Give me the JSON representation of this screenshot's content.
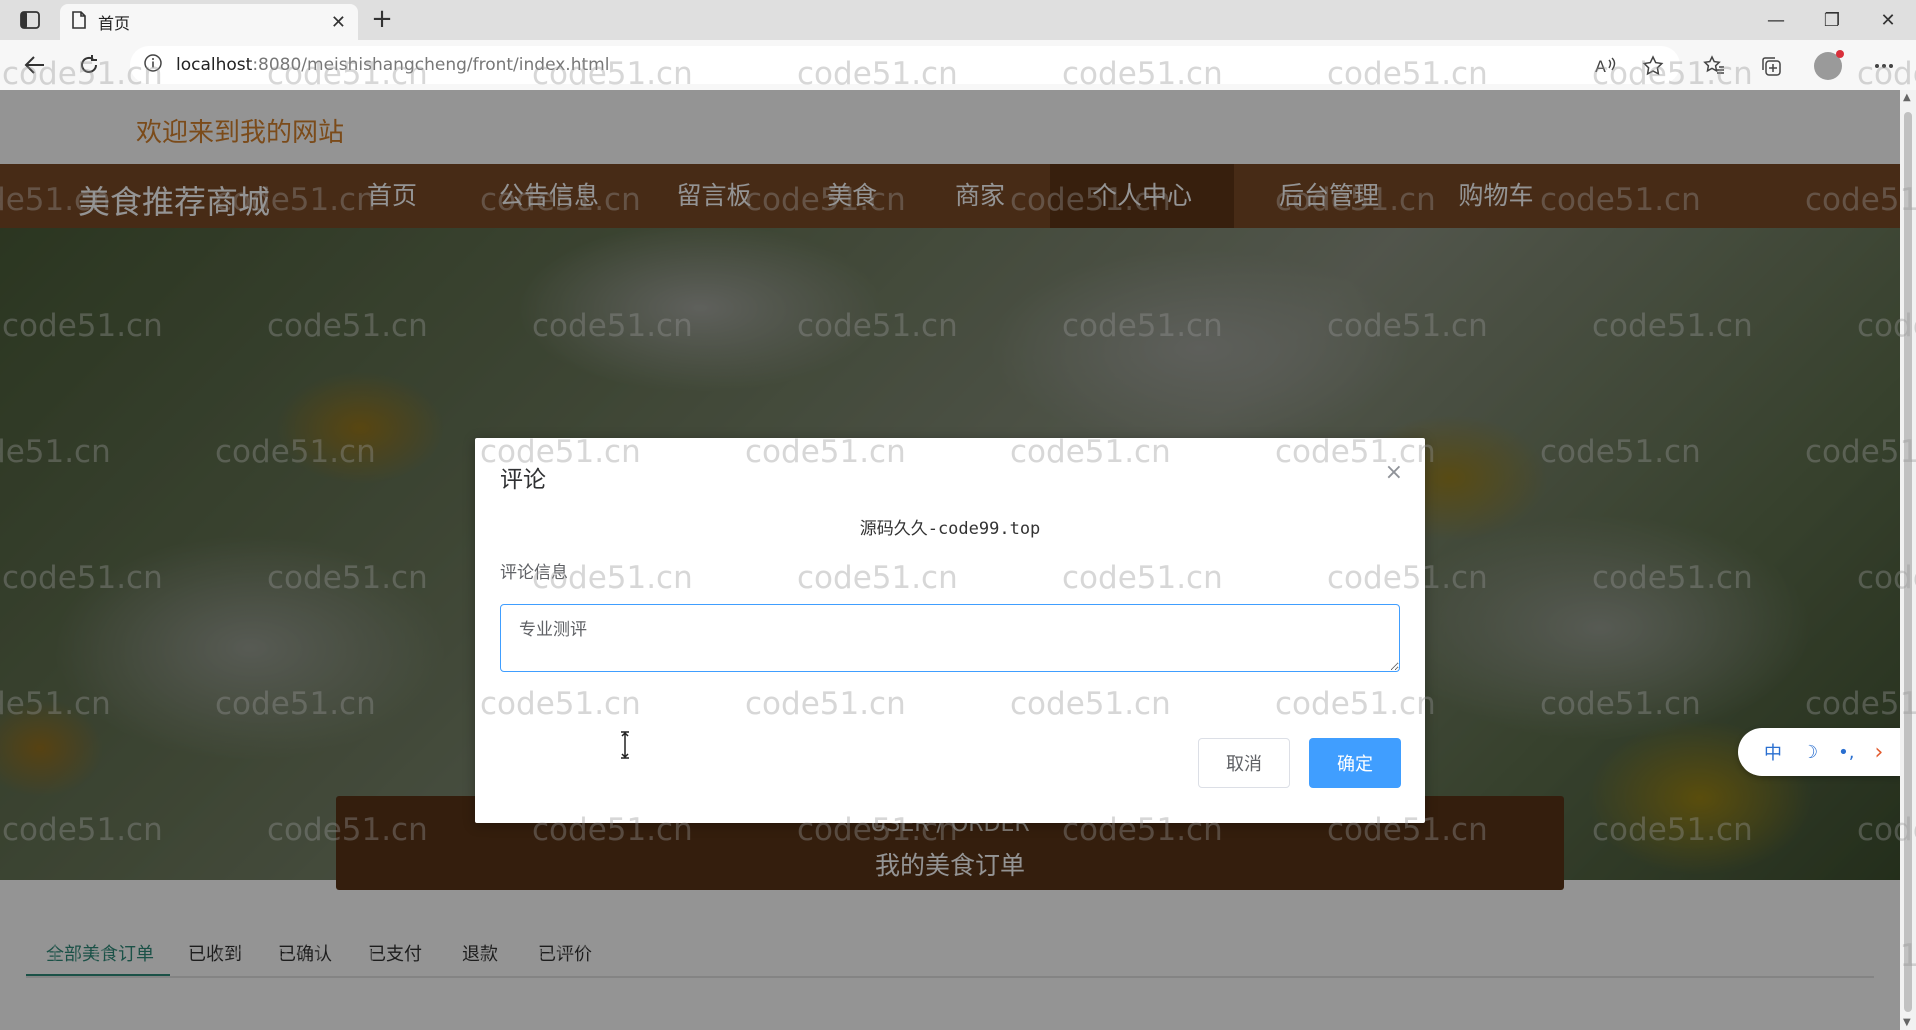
{
  "browser": {
    "tab_title": "首页",
    "tab_close": "✕",
    "new_tab": "+",
    "url_host": "localhost",
    "url_path": ":8080/meishishangcheng/front/index.html",
    "win_minimize": "—",
    "win_restore": "❐",
    "win_close": "✕"
  },
  "site": {
    "welcome": "欢迎来到我的网站",
    "brand": "美食推荐商城",
    "nav": [
      "首页",
      "公告信息",
      "留言板",
      "美食",
      "商家",
      "个人中心",
      "后台管理",
      "购物车"
    ],
    "active_nav": "个人中心"
  },
  "orders": {
    "header_en": "USER / ORDER",
    "header_cn": "我的美食订单",
    "tabs": [
      "全部美食订单",
      "已收到",
      "已确认",
      "已支付",
      "退款",
      "已评价"
    ]
  },
  "floater": {
    "lang": "中",
    "moon": "☽",
    "dots": "•,",
    "arrow": "›"
  },
  "dialog": {
    "title": "评论",
    "close": "×",
    "subtitle": "源码久久-code99.top",
    "field_label": "评论信息",
    "comment_value": "专业测评",
    "cancel": "取消",
    "confirm": "确定"
  },
  "watermark": "code51.cn",
  "colors": {
    "nav_bg": "#7b4a27",
    "nav_active": "#5f3618",
    "welcome_text": "#d5822e",
    "primary_button": "#409eff",
    "tab_active": "#2f8c7b"
  }
}
